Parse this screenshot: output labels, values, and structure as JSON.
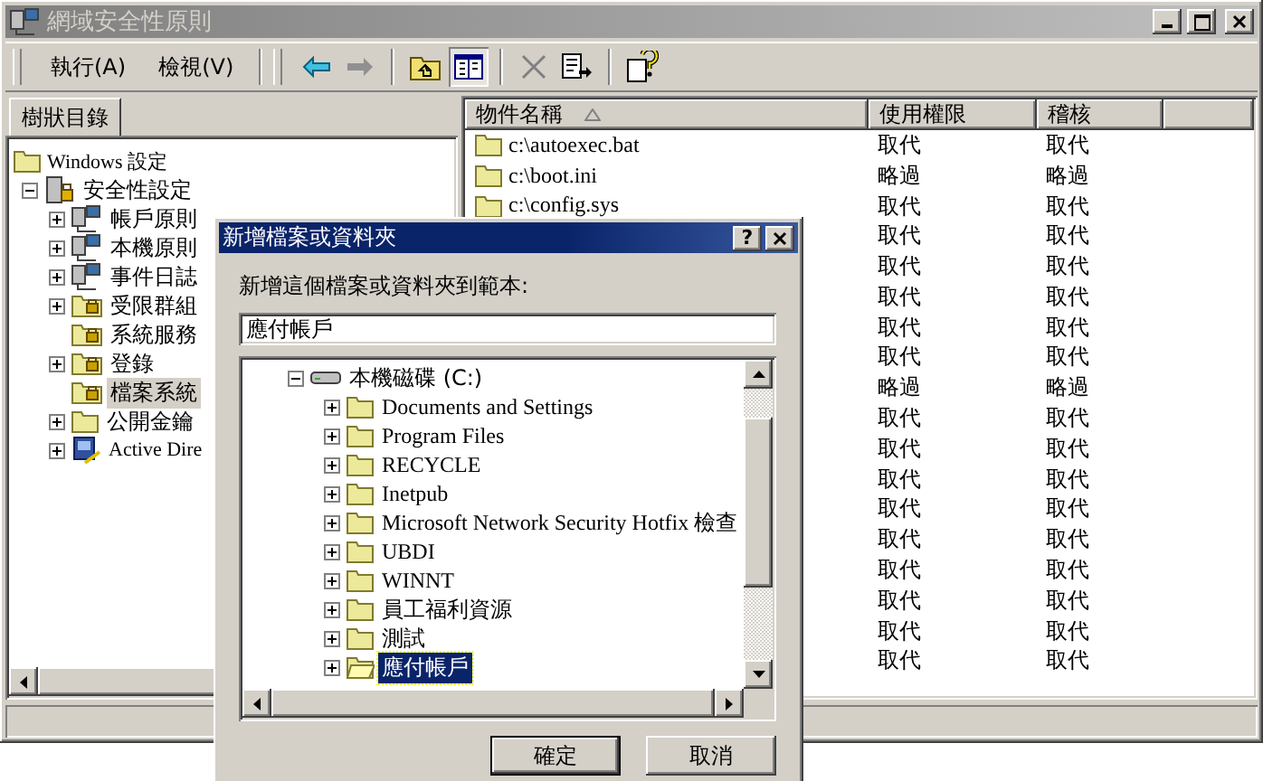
{
  "window": {
    "title": "網域安全性原則"
  },
  "menu": [
    {
      "label": "執行(A)"
    },
    {
      "label": "檢視(V)"
    }
  ],
  "toolbar": [
    {
      "kind": "back",
      "disabled": false,
      "pressed": false
    },
    {
      "kind": "forward",
      "disabled": true,
      "pressed": false
    },
    {
      "kind": "up",
      "disabled": false,
      "pressed": false
    },
    {
      "kind": "tree",
      "disabled": false,
      "pressed": true
    },
    {
      "kind": "delete",
      "disabled": true,
      "pressed": false
    },
    {
      "kind": "export",
      "disabled": false,
      "pressed": false
    },
    {
      "kind": "help",
      "disabled": false,
      "pressed": false
    }
  ],
  "tree_tab": {
    "label": "樹狀目錄"
  },
  "tree": [
    {
      "label": "Windows 設定",
      "kind": "folder",
      "selected": false,
      "children": [
        {
          "label": "安全性設定",
          "kind": "security",
          "expandable": true,
          "expanded": true,
          "selected": false,
          "children": [
            {
              "label": "帳戶原則",
              "kind": "policy",
              "expandable": true,
              "expanded": false,
              "selected": false
            },
            {
              "label": "本機原則",
              "kind": "policy",
              "expandable": true,
              "expanded": false,
              "selected": false
            },
            {
              "label": "事件日誌",
              "kind": "policy",
              "expandable": true,
              "expanded": false,
              "selected": false
            },
            {
              "label": "受限群組",
              "kind": "locked",
              "expandable": true,
              "expanded": false,
              "selected": false
            },
            {
              "label": "系統服務",
              "kind": "locked",
              "expandable": false,
              "selected": false
            },
            {
              "label": "登錄",
              "kind": "locked",
              "expandable": true,
              "expanded": false,
              "selected": false
            },
            {
              "label": "檔案系統",
              "kind": "locked",
              "expandable": false,
              "selected": true
            },
            {
              "label": "公開金鑰",
              "kind": "folder",
              "expandable": true,
              "expanded": false,
              "selected": false
            },
            {
              "label": "Active Dire",
              "kind": "directory",
              "expandable": true,
              "expanded": false,
              "selected": false
            }
          ]
        }
      ]
    }
  ],
  "list": {
    "columns": [
      {
        "label": "物件名稱",
        "sorted": true
      },
      {
        "label": "使用權限",
        "sorted": false
      },
      {
        "label": "稽核",
        "sorted": false
      }
    ],
    "rows": [
      {
        "name": "c:\\autoexec.bat",
        "permission": "取代",
        "audit": "取代"
      },
      {
        "name": "c:\\boot.ini",
        "permission": "略過",
        "audit": "略過"
      },
      {
        "name": "c:\\config.sys",
        "permission": "取代",
        "audit": "取代"
      },
      {
        "permission": "取代",
        "audit": "取代"
      },
      {
        "permission": "取代",
        "audit": "取代"
      },
      {
        "permission": "取代",
        "audit": "取代"
      },
      {
        "permission": "取代",
        "audit": "取代"
      },
      {
        "permission": "取代",
        "audit": "取代"
      },
      {
        "permission": "略過",
        "audit": "略過"
      },
      {
        "permission": "取代",
        "audit": "取代"
      },
      {
        "permission": "取代",
        "audit": "取代"
      },
      {
        "permission": "取代",
        "audit": "取代"
      },
      {
        "permission": "取代",
        "audit": "取代"
      },
      {
        "permission": "取代",
        "audit": "取代"
      },
      {
        "permission": "取代",
        "audit": "取代"
      },
      {
        "permission": "取代",
        "audit": "取代"
      },
      {
        "permission": "取代",
        "audit": "取代"
      },
      {
        "permission": "取代",
        "audit": "取代"
      }
    ]
  },
  "dialog": {
    "title": "新增檔案或資料夾",
    "title_buttons": [
      "?"
    ],
    "prompt": "新增這個檔案或資料夾到範本:",
    "value": "應付帳戶",
    "tree": {
      "label": "本機磁碟 (C:)",
      "expanded": true,
      "children": [
        {
          "label": "Documents and Settings",
          "selected": false
        },
        {
          "label": "Program Files",
          "selected": false
        },
        {
          "label": "RECYCLE",
          "selected": false
        },
        {
          "label": "Inetpub",
          "selected": false
        },
        {
          "label": "Microsoft Network Security Hotfix 檢查",
          "selected": false
        },
        {
          "label": "UBDI",
          "selected": false
        },
        {
          "label": "WINNT",
          "selected": false
        },
        {
          "label": "員工福利資源",
          "selected": false
        },
        {
          "label": "測試",
          "selected": false
        },
        {
          "label": "應付帳戶",
          "selected": true
        }
      ]
    },
    "buttons": [
      {
        "label": "確定",
        "default": true
      },
      {
        "label": "取消",
        "default": false
      }
    ]
  }
}
